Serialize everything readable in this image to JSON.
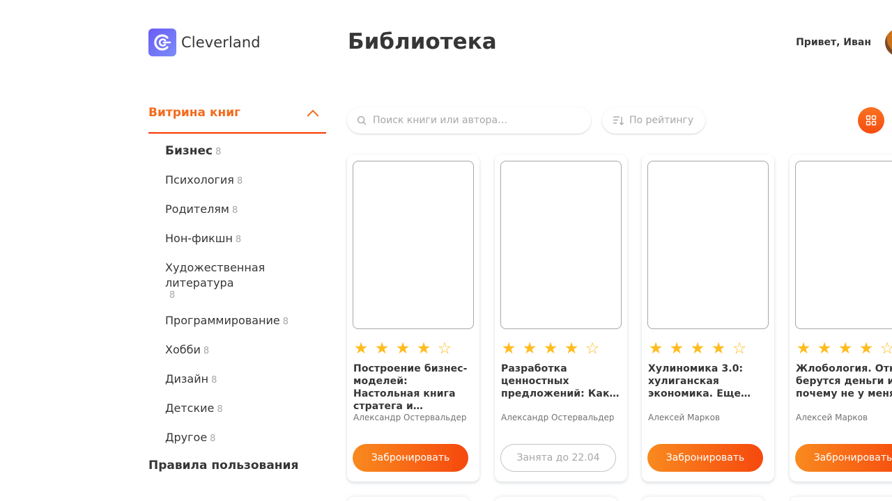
{
  "brand": {
    "name": "Cleverland",
    "accent": "#f36b1c",
    "logo_color": "#6b5cf6"
  },
  "header": {
    "title": "Библиотека",
    "greeting": "Привет, Иван"
  },
  "sidebar": {
    "section_title": "Витрина книг",
    "categories": [
      {
        "label": "Бизнес",
        "count": "8",
        "active": true
      },
      {
        "label": "Психология",
        "count": "8"
      },
      {
        "label": "Родителям",
        "count": "8"
      },
      {
        "label": "Нон-фикшн",
        "count": "8"
      },
      {
        "label": "Художественная литература",
        "count": "8"
      },
      {
        "label": "Программирование",
        "count": "8"
      },
      {
        "label": "Хобби",
        "count": "8"
      },
      {
        "label": "Дизайн",
        "count": "8"
      },
      {
        "label": "Детские",
        "count": "8"
      },
      {
        "label": "Другое",
        "count": "8"
      }
    ],
    "rules": "Правила пользования"
  },
  "toolbar": {
    "search_placeholder": "Поиск книги или автора…",
    "sort_label": "По рейтингу"
  },
  "books": [
    {
      "title": "Построение бизнес-моделей: Настольная книга стратега и…",
      "author": "Александр Остервальдер",
      "rating": 4,
      "button": "Забронировать",
      "status": "available"
    },
    {
      "title": "Разработка ценностных предложений: Как…",
      "author": "Александр Остервальдер",
      "rating": 4,
      "button": "Занята до 22.04",
      "status": "busy"
    },
    {
      "title": "Хулиномика 3.0: хулиганская экономика. Еще…",
      "author": "Алексей Марков",
      "rating": 4,
      "button": "Забронировать",
      "status": "available"
    },
    {
      "title": "Жлобология. Откуда берутся деньги и почему не у меня",
      "author": "Алексей Марков",
      "rating": 4,
      "button": "Забронировать",
      "status": "available"
    }
  ]
}
